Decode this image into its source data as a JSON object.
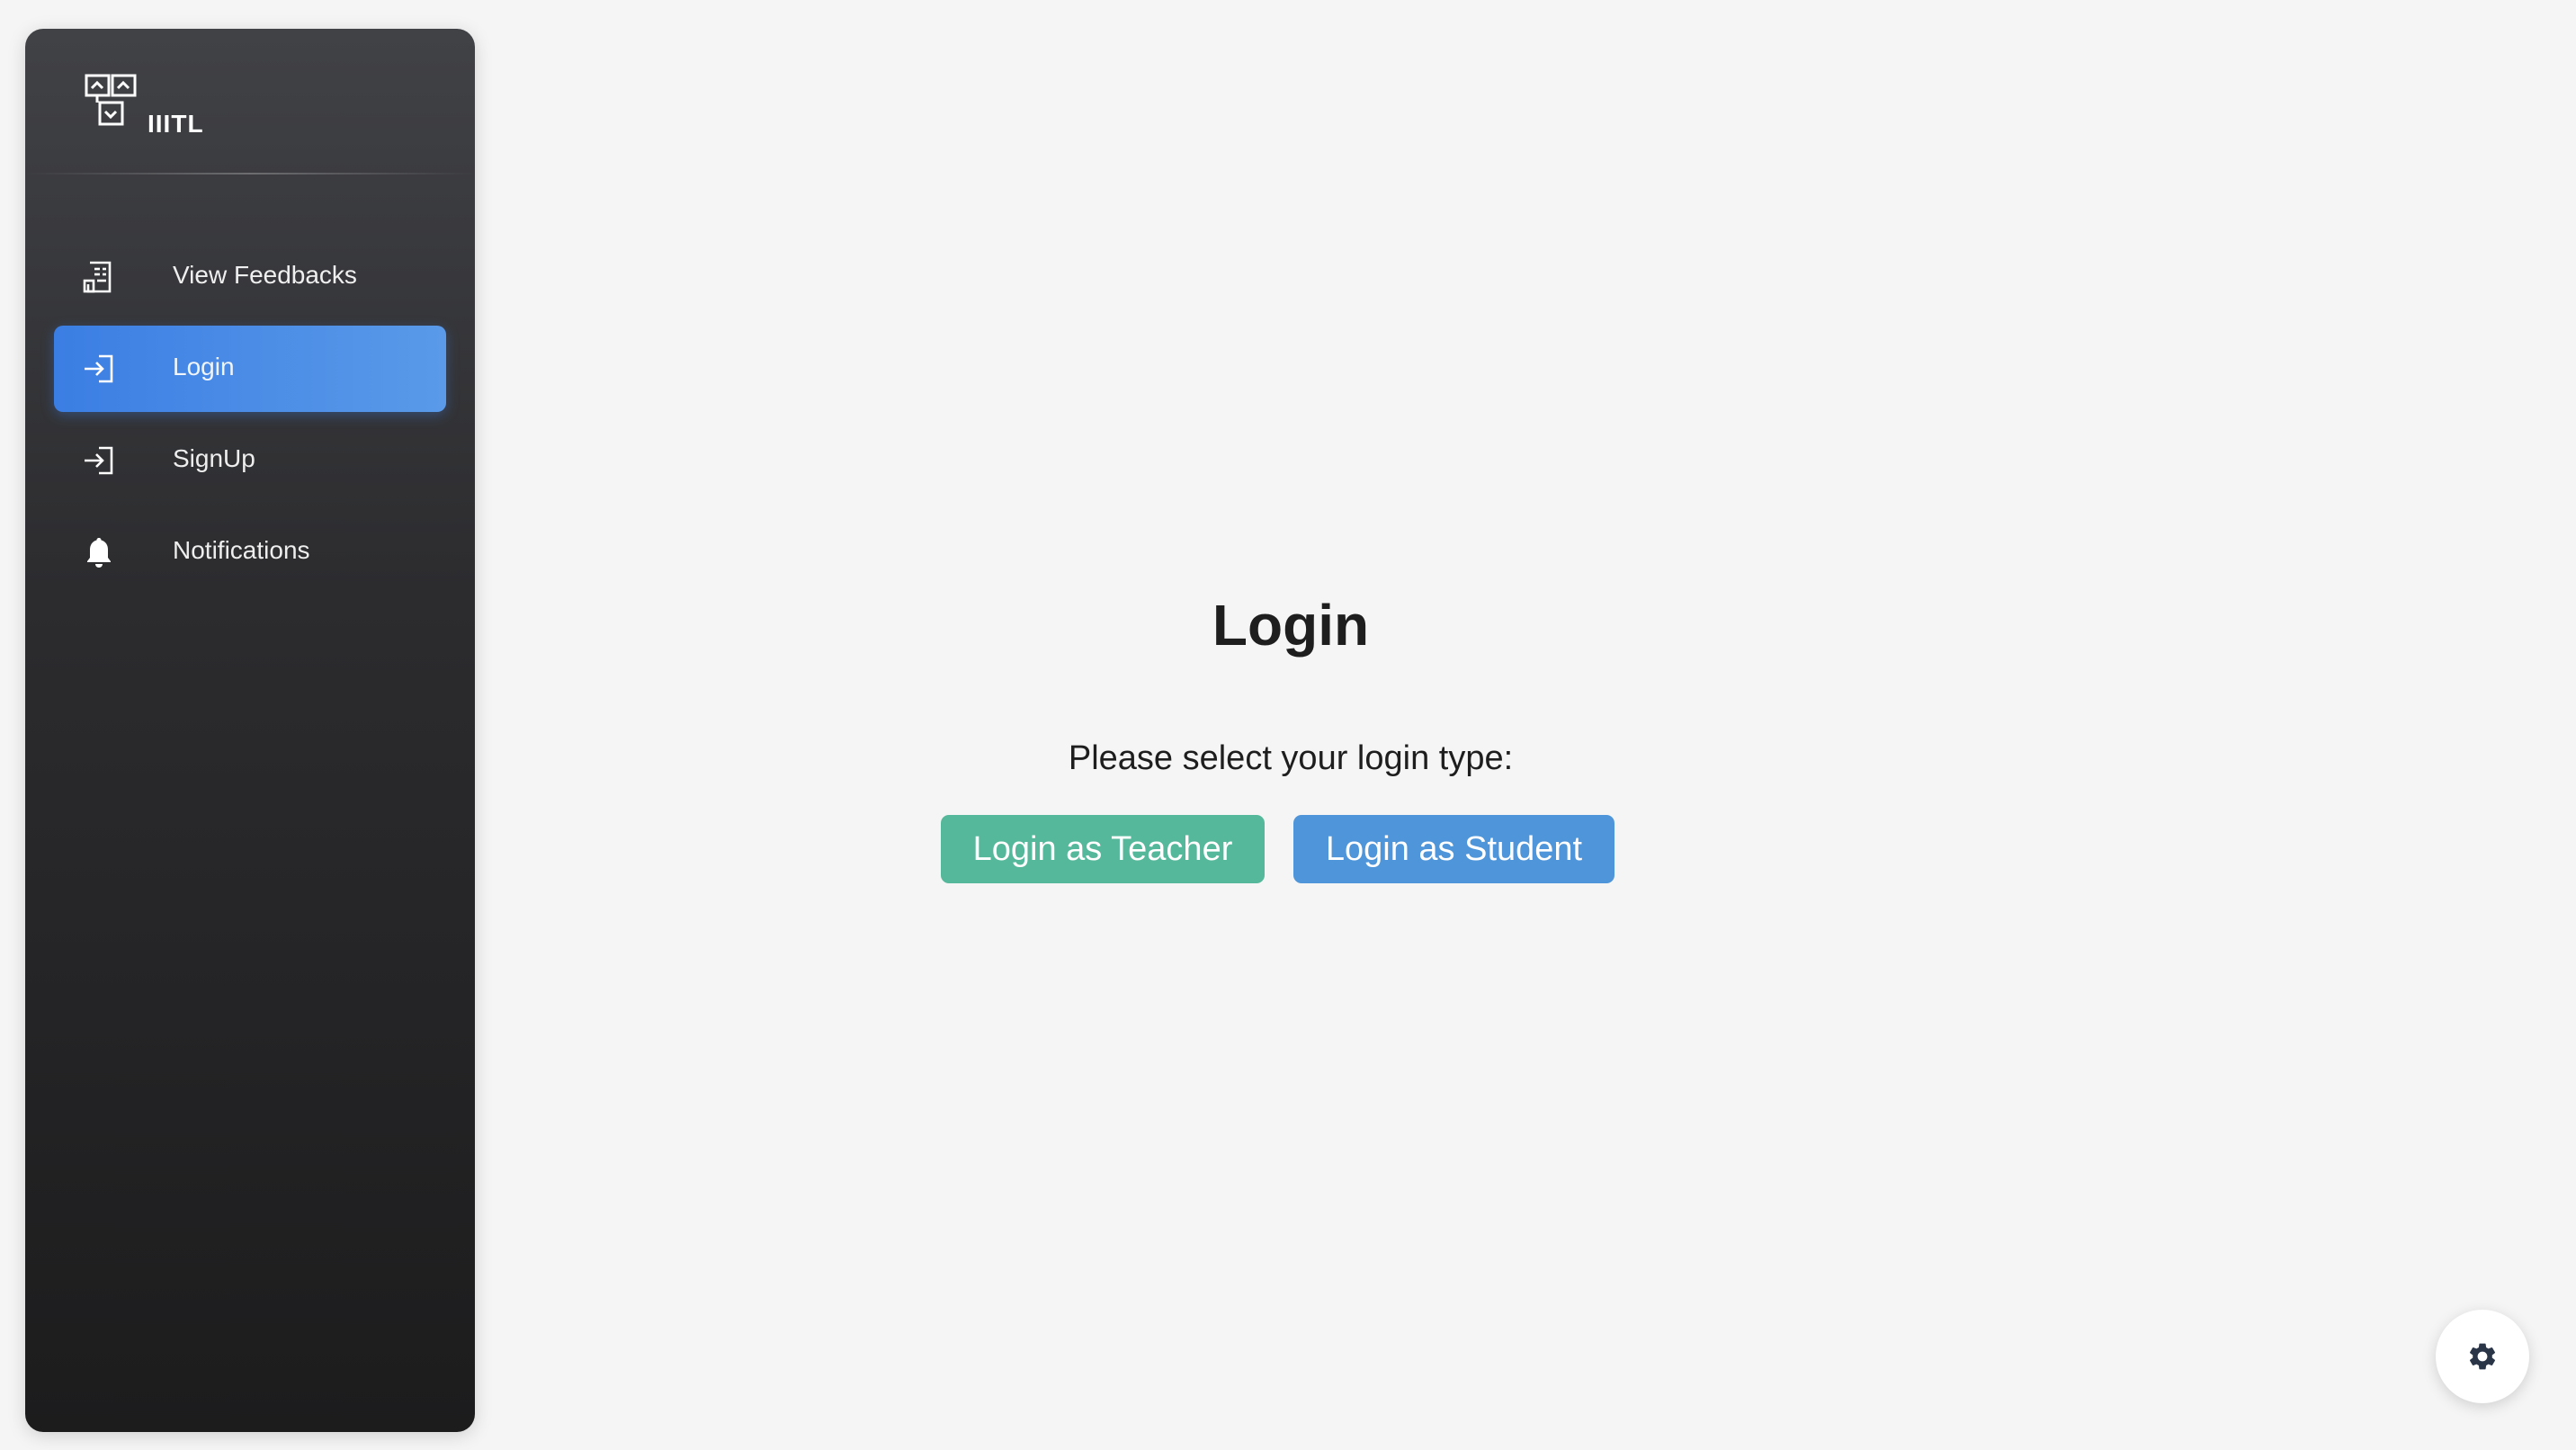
{
  "sidebar": {
    "brand": {
      "name": "IIITL",
      "icon": "logo-flowchart-icon"
    },
    "items": [
      {
        "label": "View Feedbacks",
        "icon": "receipt-icon",
        "active": false
      },
      {
        "label": "Login",
        "icon": "login-arrow-icon",
        "active": true
      },
      {
        "label": "SignUp",
        "icon": "login-arrow-icon",
        "active": false
      },
      {
        "label": "Notifications",
        "icon": "bell-icon",
        "active": false
      }
    ]
  },
  "main": {
    "title": "Login",
    "prompt": "Please select your login type:",
    "buttons": {
      "teacher": "Login as Teacher",
      "student": "Login as Student"
    }
  },
  "settings": {
    "icon": "gear-icon"
  },
  "colors": {
    "active_nav": "#3b7ee3",
    "teacher_button": "#56b89a",
    "student_button": "#4f95d9",
    "background": "#f5f5f5"
  }
}
